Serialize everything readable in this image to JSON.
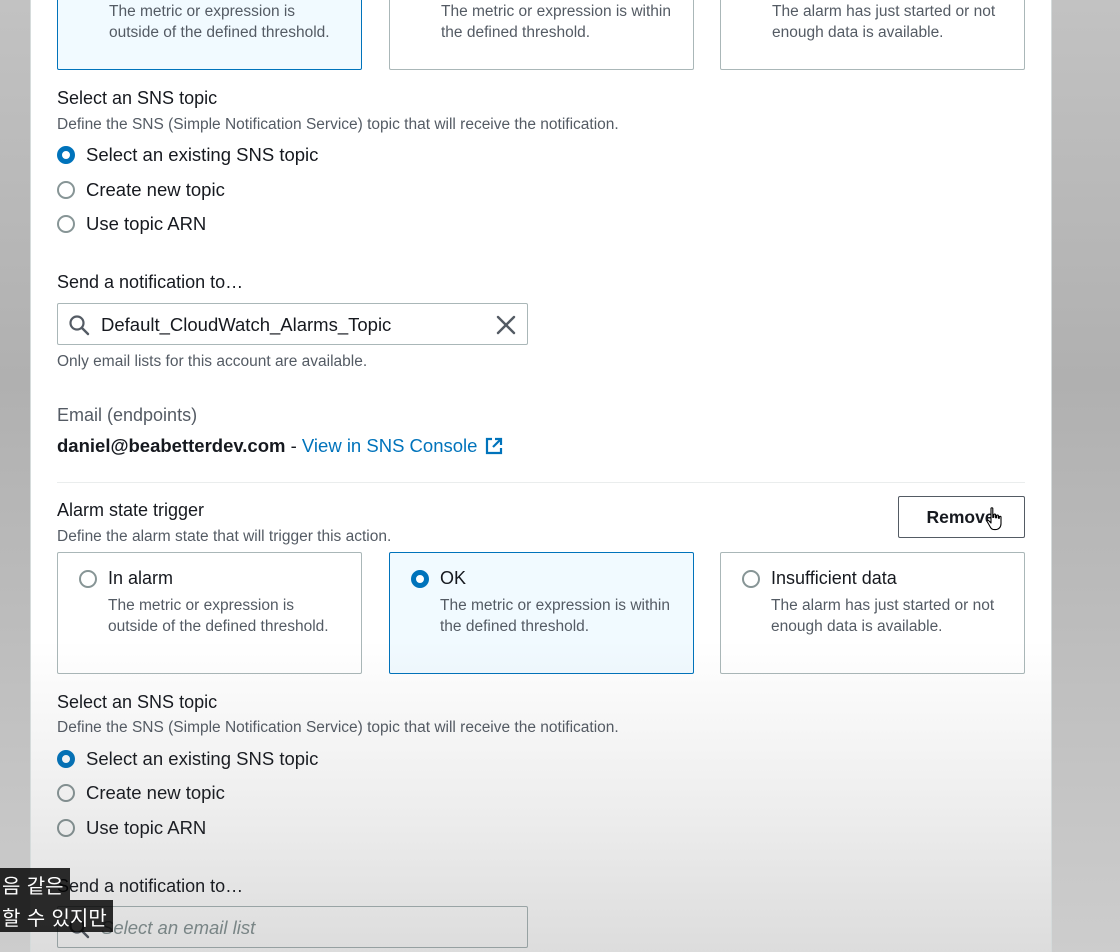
{
  "top_cards": [
    {
      "desc": "The metric or expression is outside of the defined threshold.",
      "selected": true
    },
    {
      "desc": "The metric or expression is within the defined threshold.",
      "selected": false
    },
    {
      "desc": "The alarm has just started or not enough data is available.",
      "selected": false
    }
  ],
  "sns1": {
    "heading": "Select an SNS topic",
    "desc": "Define the SNS (Simple Notification Service) topic that will receive the notification.",
    "options": [
      "Select an existing SNS topic",
      "Create new topic",
      "Use topic ARN"
    ],
    "selected_index": 0,
    "send_label": "Send a notification to…",
    "input_value": "Default_CloudWatch_Alarms_Topic",
    "helper": "Only email lists for this account are available.",
    "email_label": "Email (endpoints)",
    "email_value": "daniel@beabetterdev.com",
    "separator": " - ",
    "console_link": "View in SNS Console"
  },
  "trigger": {
    "heading": "Alarm state trigger",
    "desc": "Define the alarm state that will trigger this action.",
    "remove_label": "Remove",
    "cards": [
      {
        "title": "In alarm",
        "desc": "The metric or expression is outside of the defined threshold.",
        "selected": false
      },
      {
        "title": "OK",
        "desc": "The metric or expression is within the defined threshold.",
        "selected": true
      },
      {
        "title": "Insufficient data",
        "desc": "The alarm has just started or not enough data is available.",
        "selected": false
      }
    ]
  },
  "sns2": {
    "heading": "Select an SNS topic",
    "desc": "Define the SNS (Simple Notification Service) topic that will receive the notification.",
    "options": [
      "Select an existing SNS topic",
      "Create new topic",
      "Use topic ARN"
    ],
    "selected_index": 0,
    "send_label": "Send a notification to…",
    "input_placeholder": "Select an email list"
  },
  "subtitles": [
    "음 같은",
    "할 수 있지만"
  ],
  "colors": {
    "accent": "#0073bb",
    "selected_bg": "#f1faff",
    "border": "#aab7b8",
    "muted_text": "#545b64"
  }
}
